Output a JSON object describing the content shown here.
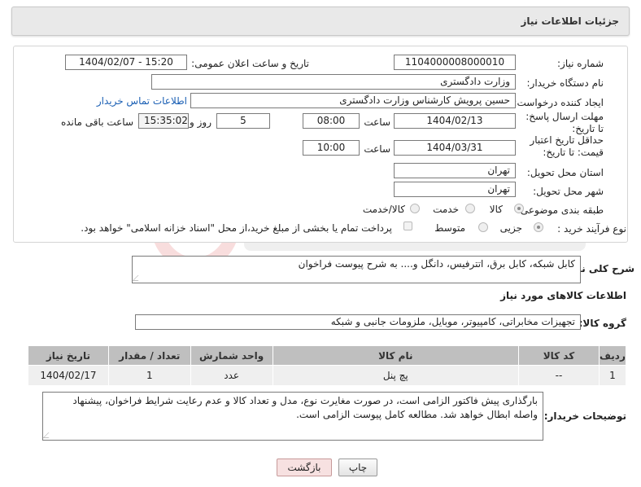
{
  "header": {
    "title": "جزئیات اطلاعات نیاز"
  },
  "form": {
    "need_number_label": "شماره نیاز:",
    "need_number": "1104000008000010",
    "announce_label": "تاریخ و ساعت اعلان عمومی:",
    "announce_value": "1404/02/07 - 15:20",
    "buyer_org_label": "نام دستگاه خریدار:",
    "buyer_org": "وزارت دادگستری",
    "creator_label": "ایجاد کننده درخواست:",
    "creator": "حسین پرویش کارشناس وزارت دادگستری",
    "contact_link": "اطلاعات تماس خریدار",
    "deadline_label": "مهلت ارسال پاسخ: تا تاریخ:",
    "deadline_date": "1404/02/13",
    "deadline_time_label": "ساعت",
    "deadline_time": "08:00",
    "days_value": "5",
    "days_label": "روز و",
    "remaining_time": "15:35:02",
    "remaining_label": "ساعت باقی مانده",
    "price_valid_label": "حداقل تاریخ اعتبار قیمت: تا تاریخ:",
    "price_valid_date": "1404/03/31",
    "price_valid_time_label": "ساعت",
    "price_valid_time": "10:00",
    "province_label": "استان محل تحویل:",
    "province": "تهران",
    "city_label": "شهر محل تحویل:",
    "city": "تهران",
    "category_label": "طبقه بندی موضوعی:",
    "category_options": [
      "کالا",
      "خدمت",
      "کالا/خدمت"
    ],
    "category_selected": "کالا",
    "process_label": "نوع فرآیند خرید :",
    "process_options": [
      "جزیی",
      "متوسط"
    ],
    "process_selected": "جزیی",
    "payment_note": "پرداخت تمام یا بخشی از مبلغ خرید،از محل \"اسناد خزانه اسلامی\" خواهد بود."
  },
  "description": {
    "label": "شرح کلی نیاز:",
    "text": "کابل شبکه، کابل برق، اتترفیس، دانگل و.... به شرح پیوست فراخوان"
  },
  "goods": {
    "section_title": "اطلاعات کالاهای مورد نیاز",
    "group_label": "گروه کالا:",
    "group_value": "تجهیزات مخابراتی، کامپیوتر، موبایل، ملزومات جانبی و شبکه",
    "columns": [
      "ردیف",
      "کد کالا",
      "نام کالا",
      "واحد شمارش",
      "تعداد / مقدار",
      "تاریخ نیاز"
    ],
    "rows": [
      [
        "1",
        "--",
        "پچ پنل",
        "عدد",
        "1",
        "1404/02/17"
      ]
    ]
  },
  "buyer_notes": {
    "label": "توضیحات خریدار:",
    "text": "بارگذاری پیش فاکتور الزامی است، در صورت مغایرت نوع، مدل و تعداد کالا و عدم رعایت شرایط فراخوان، پیشنهاد واصله ابطال خواهد شد. مطالعه کامل پیوست الزامی است."
  },
  "buttons": {
    "print": "چاپ",
    "back": "بازگشت"
  },
  "colors": {
    "link": "#1a5fb4",
    "table_header": "#bfbfbf",
    "back_button": "#f7e1e1"
  }
}
